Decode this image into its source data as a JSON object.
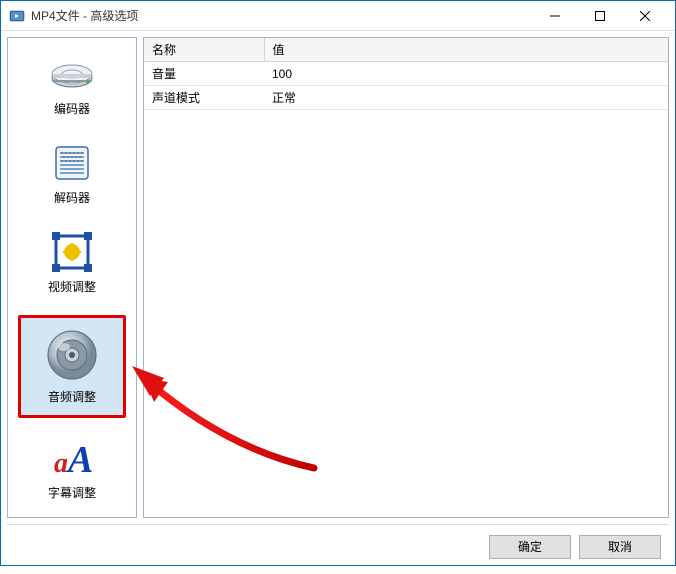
{
  "window": {
    "title": "MP4文件 - 高级选项"
  },
  "sidebar": {
    "items": [
      {
        "label": "编码器"
      },
      {
        "label": "解码器"
      },
      {
        "label": "视频调整"
      },
      {
        "label": "音频调整"
      },
      {
        "label": "字幕调整"
      }
    ]
  },
  "table": {
    "headers": {
      "name": "名称",
      "value": "值"
    },
    "rows": [
      {
        "name": "音量",
        "value": "100"
      },
      {
        "name": "声道模式",
        "value": "正常"
      }
    ]
  },
  "buttons": {
    "ok": "确定",
    "cancel": "取消"
  }
}
